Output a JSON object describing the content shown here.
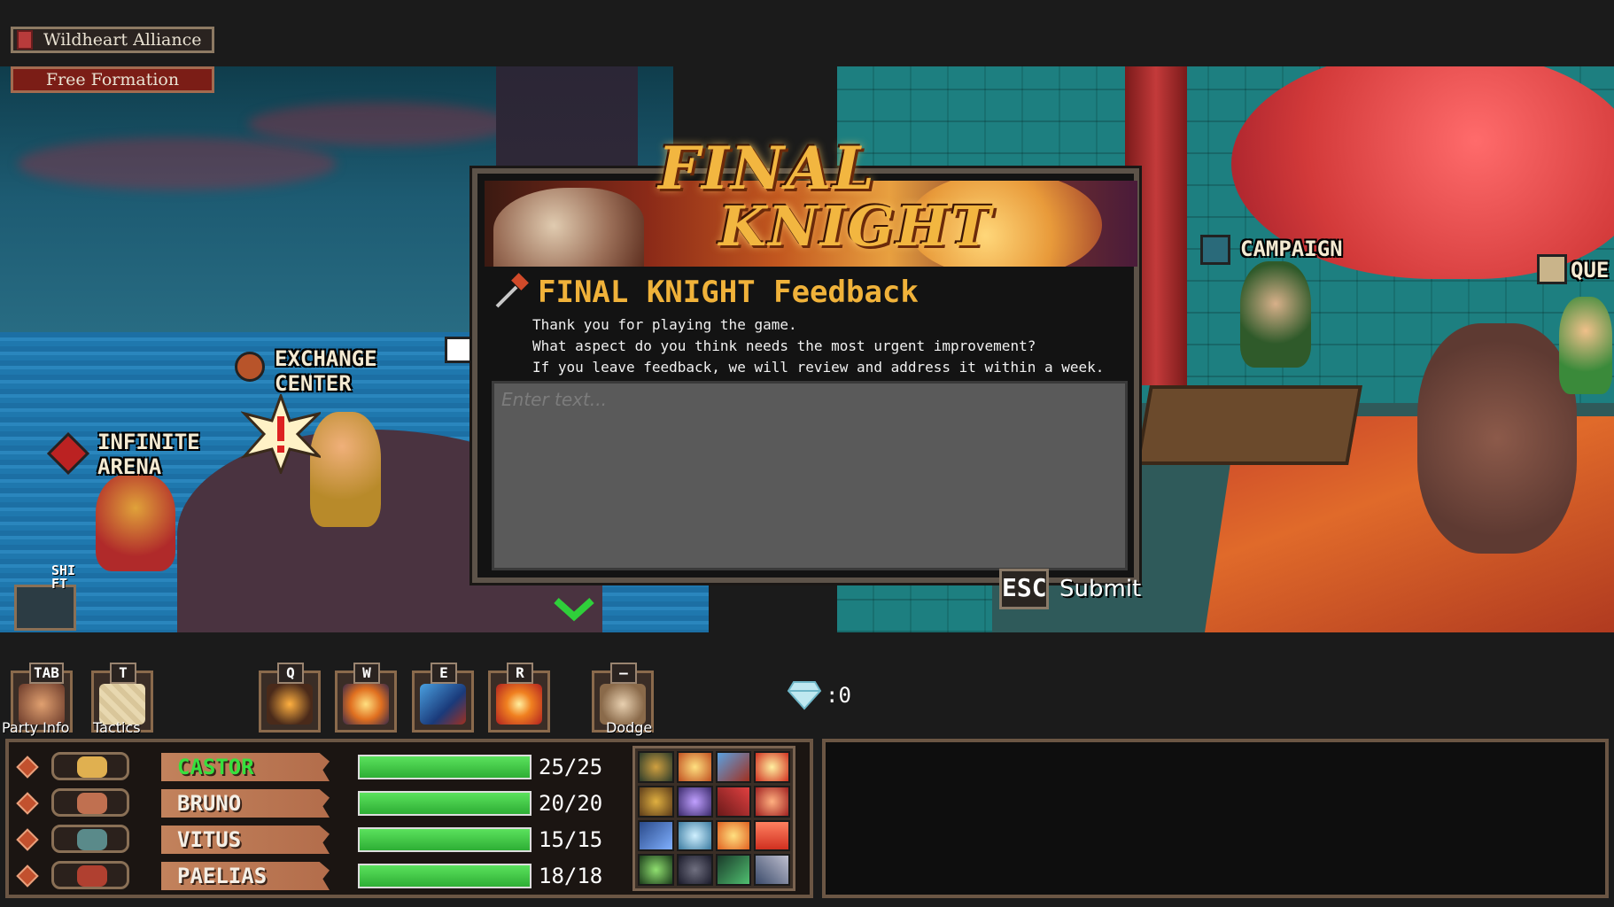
{
  "banners": {
    "alliance": "Wildheart Alliance",
    "formation": "Free Formation"
  },
  "scene": {
    "locations": {
      "exchange": "EXCHANGE\nCENTER",
      "arena": "INFINITE\nARENA",
      "campaign": "CAMPAIGN",
      "quest": "QUE"
    },
    "shift_key": "SHI\nFT"
  },
  "dialog": {
    "logo_line1": "FINAL",
    "logo_line2": "KNIGHT",
    "title": "FINAL KNIGHT Feedback",
    "message_lines": [
      "Thank you for playing the game.",
      "What aspect do you think needs the most urgent improvement?",
      "If you leave feedback, we will review and address it within a week."
    ],
    "input_placeholder": "Enter text...",
    "input_value": "",
    "esc_key": "ESC",
    "submit_label": "Submit"
  },
  "skill_bar": {
    "slots": [
      {
        "key": "TAB",
        "label": "Party Info"
      },
      {
        "key": "T",
        "label": "Tactics"
      },
      {
        "key": "Q",
        "label": ""
      },
      {
        "key": "W",
        "label": ""
      },
      {
        "key": "E",
        "label": ""
      },
      {
        "key": "R",
        "label": ""
      },
      {
        "key": "—",
        "label": "Dodge"
      }
    ],
    "gem_count": ":0"
  },
  "party": [
    {
      "name": "CASTOR",
      "hp": "25/25",
      "hp_fraction": 1.0,
      "active": true
    },
    {
      "name": "BRUNO",
      "hp": "20/20",
      "hp_fraction": 1.0,
      "active": false
    },
    {
      "name": "VITUS",
      "hp": "15/15",
      "hp_fraction": 1.0,
      "active": false
    },
    {
      "name": "PAELIAS",
      "hp": "18/18",
      "hp_fraction": 1.0,
      "active": false
    }
  ],
  "colors": {
    "title_gold": "#f0b23a",
    "active_name_green": "#36e03d",
    "hp_green": "#3fca44",
    "panel_border": "#6b5644"
  }
}
